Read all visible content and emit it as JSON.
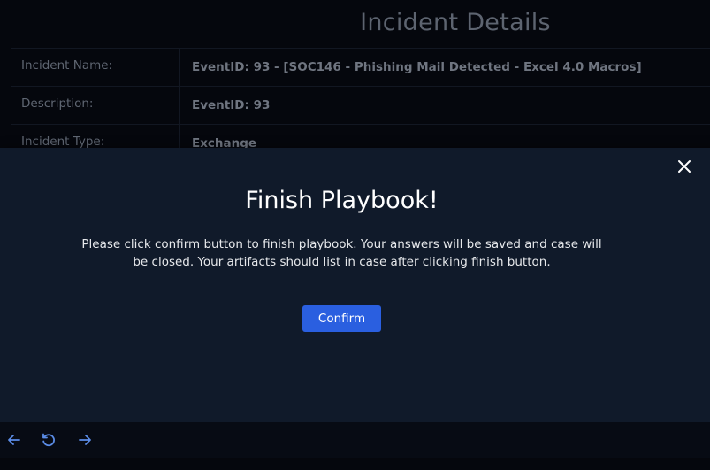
{
  "page": {
    "title": "Incident Details"
  },
  "details": [
    {
      "label": "Incident Name:",
      "value": "EventID: 93 - [SOC146 - Phishing Mail Detected - Excel 4.0 Macros]"
    },
    {
      "label": "Description:",
      "value": "EventID: 93"
    },
    {
      "label": "Incident Type:",
      "value": "Exchange"
    }
  ],
  "modal": {
    "title": "Finish Playbook!",
    "message": "Please click confirm button to finish playbook. Your answers will be saved and case will be closed. Your artifacts should list in case after clicking finish button.",
    "confirm_label": "Confirm",
    "close_icon": "close-icon"
  },
  "nav": {
    "back_icon": "arrow-left-icon",
    "reload_icon": "reload-icon",
    "forward_icon": "arrow-right-icon"
  },
  "colors": {
    "background": "#05070d",
    "modal_background": "#101a2a",
    "accent": "#2a5fe0"
  }
}
